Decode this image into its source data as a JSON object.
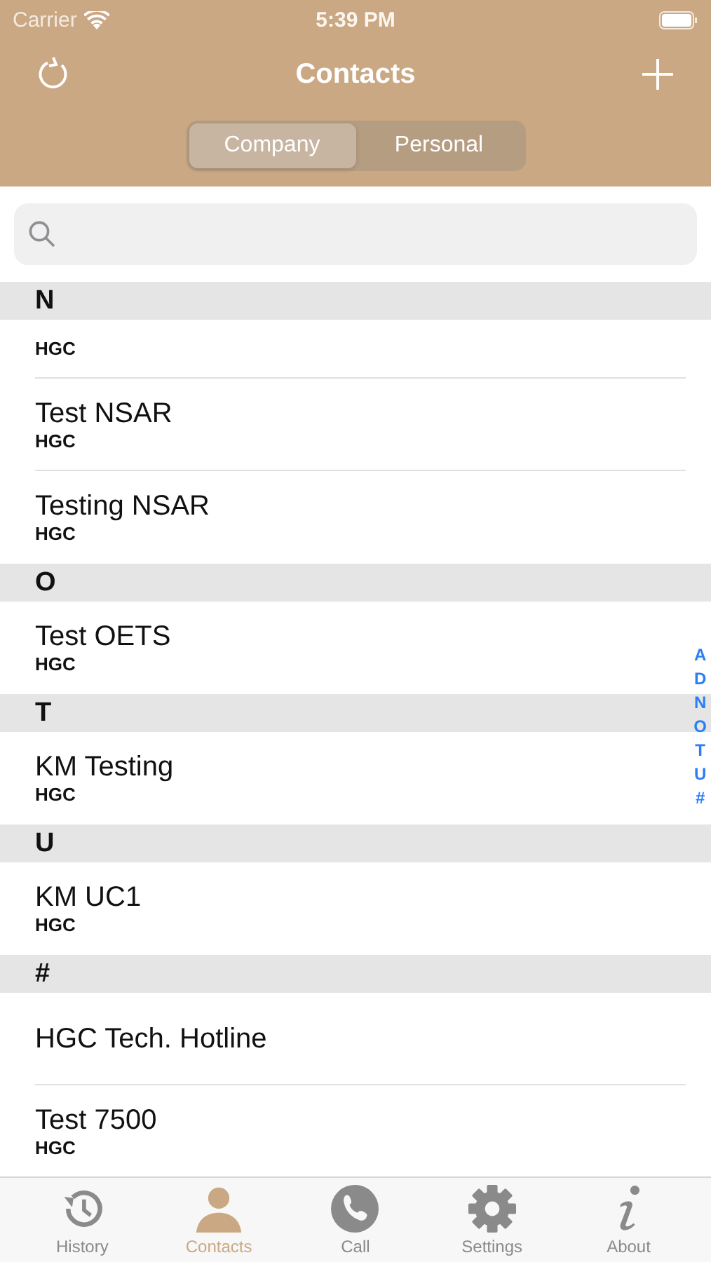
{
  "status_bar": {
    "carrier": "Carrier",
    "time": "5:39 PM"
  },
  "nav": {
    "title": "Contacts"
  },
  "segments": [
    {
      "label": "Company",
      "selected": true
    },
    {
      "label": "Personal",
      "selected": false
    }
  ],
  "sections": [
    {
      "letter": "N",
      "contacts": [
        {
          "company": "HGC"
        },
        {
          "name": "Test NSAR",
          "company": "HGC"
        },
        {
          "name": "Testing NSAR",
          "company": "HGC"
        }
      ]
    },
    {
      "letter": "O",
      "contacts": [
        {
          "name": "Test OETS",
          "company": "HGC"
        }
      ]
    },
    {
      "letter": "T",
      "contacts": [
        {
          "name": "KM Testing",
          "company": "HGC"
        }
      ]
    },
    {
      "letter": "U",
      "contacts": [
        {
          "name": "KM UC1",
          "company": "HGC"
        }
      ]
    },
    {
      "letter": "#",
      "contacts": [
        {
          "name": "HGC Tech. Hotline"
        },
        {
          "name": "Test 7500",
          "company": "HGC"
        }
      ]
    }
  ],
  "index": [
    "A",
    "D",
    "N",
    "O",
    "T",
    "U",
    "#"
  ],
  "tabs": [
    {
      "label": "History",
      "kind": "history",
      "selected": false
    },
    {
      "label": "Contacts",
      "kind": "contacts",
      "selected": true
    },
    {
      "label": "Call",
      "kind": "call",
      "selected": false
    },
    {
      "label": "Settings",
      "kind": "settings",
      "selected": false
    },
    {
      "label": "About",
      "kind": "about",
      "selected": false
    }
  ]
}
